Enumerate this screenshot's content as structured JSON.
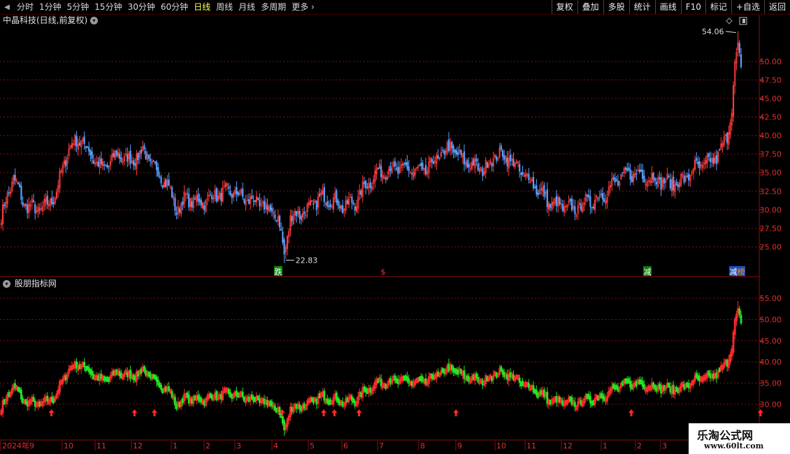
{
  "toolbar": {
    "periods": [
      "分时",
      "1分钟",
      "5分钟",
      "15分钟",
      "30分钟",
      "60分钟",
      "日线",
      "周线",
      "月线",
      "多周期",
      "更多"
    ],
    "active_period": "日线",
    "actions": [
      "复权",
      "叠加",
      "多股",
      "统计",
      "画线",
      "F10",
      "标记",
      "+自选",
      "返回"
    ]
  },
  "main_panel": {
    "title": "中晶科技(日线,前复权)",
    "high_label": "54.06",
    "low_label": "22.83",
    "y_ticks": [
      "50.00",
      "47.50",
      "45.00",
      "42.50",
      "40.00",
      "37.50",
      "35.00",
      "32.50",
      "30.00",
      "27.50",
      "25.00"
    ],
    "markers": [
      "跌",
      "$",
      "减",
      "减",
      "榜"
    ]
  },
  "sub_panel": {
    "title": "股朋指标网",
    "y_ticks": [
      "55.00",
      "50.00",
      "45.00",
      "40.00",
      "35.00",
      "30.00"
    ]
  },
  "x_axis": {
    "labels": [
      "2024年",
      "9",
      "10",
      "11",
      "12",
      "1",
      "2",
      "3",
      "4",
      "5",
      "6",
      "7",
      "8",
      "9",
      "10",
      "11",
      "12",
      "1",
      "2",
      "3"
    ]
  },
  "watermark": {
    "name": "乐淘公式网",
    "url": "www.60lt.com"
  },
  "chart_data": {
    "type": "candlestick",
    "ylim": [
      22.5,
      54.5
    ],
    "sub_ylim": [
      26.5,
      57.0
    ],
    "anchors": [
      [
        0,
        29.0
      ],
      [
        8,
        34.5
      ],
      [
        14,
        31.0
      ],
      [
        22,
        30.0
      ],
      [
        30,
        30.5
      ],
      [
        36,
        32.5
      ],
      [
        44,
        38.5
      ],
      [
        52,
        39.5
      ],
      [
        58,
        37.5
      ],
      [
        66,
        35.5
      ],
      [
        76,
        37.5
      ],
      [
        84,
        36.5
      ],
      [
        92,
        38.0
      ],
      [
        100,
        35.5
      ],
      [
        108,
        33.5
      ],
      [
        114,
        30.0
      ],
      [
        120,
        31.5
      ],
      [
        130,
        31.0
      ],
      [
        140,
        32.0
      ],
      [
        150,
        32.5
      ],
      [
        158,
        31.5
      ],
      [
        166,
        31.0
      ],
      [
        174,
        30.0
      ],
      [
        180,
        29.0
      ],
      [
        184,
        24.0
      ],
      [
        188,
        29.0
      ],
      [
        194,
        29.5
      ],
      [
        200,
        30.0
      ],
      [
        206,
        31.5
      ],
      [
        214,
        31.5
      ],
      [
        222,
        30.5
      ],
      [
        230,
        31.0
      ],
      [
        236,
        33.0
      ],
      [
        244,
        35.0
      ],
      [
        254,
        35.5
      ],
      [
        264,
        35.5
      ],
      [
        274,
        35.0
      ],
      [
        284,
        37.0
      ],
      [
        292,
        38.5
      ],
      [
        298,
        37.0
      ],
      [
        306,
        36.0
      ],
      [
        314,
        35.5
      ],
      [
        322,
        37.5
      ],
      [
        330,
        37.0
      ],
      [
        338,
        35.0
      ],
      [
        344,
        34.0
      ],
      [
        350,
        32.5
      ],
      [
        356,
        31.0
      ],
      [
        364,
        30.5
      ],
      [
        372,
        30.0
      ],
      [
        380,
        31.0
      ],
      [
        388,
        31.5
      ],
      [
        396,
        33.0
      ],
      [
        404,
        34.5
      ],
      [
        412,
        35.0
      ],
      [
        420,
        34.5
      ],
      [
        428,
        34.0
      ],
      [
        436,
        33.5
      ],
      [
        444,
        34.0
      ],
      [
        450,
        35.5
      ],
      [
        456,
        36.0
      ],
      [
        462,
        36.5
      ],
      [
        468,
        38.0
      ],
      [
        472,
        40.0
      ],
      [
        475,
        44.0
      ],
      [
        477,
        49.0
      ],
      [
        479,
        52.0
      ],
      [
        481,
        49.0
      ]
    ],
    "high": 54.06,
    "high_index": 479,
    "low": 22.83,
    "low_index": 184,
    "sub_arrows": [
      33,
      87,
      100,
      183,
      210,
      217,
      233,
      296,
      410,
      494,
      722
    ]
  }
}
